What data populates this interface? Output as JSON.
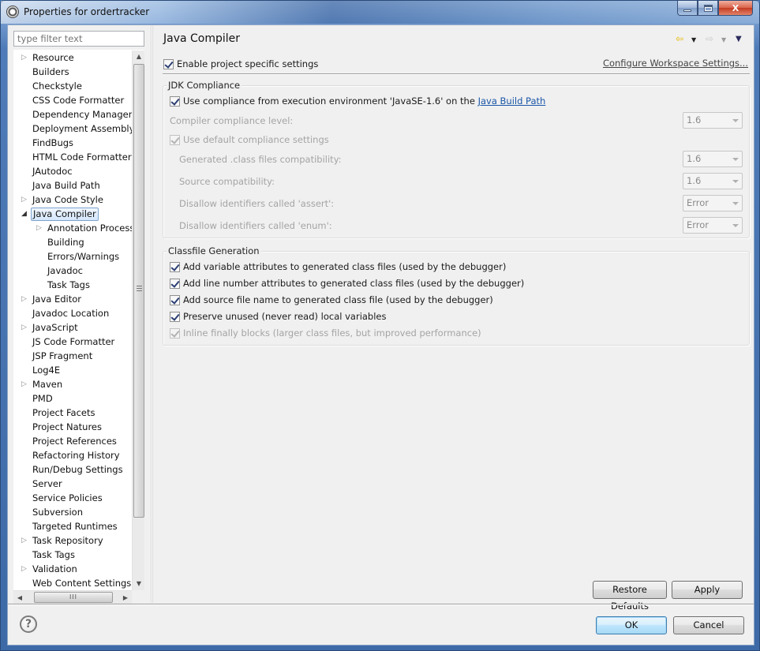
{
  "window": {
    "title": "Properties for ordertracker",
    "controls": {
      "minimize": "minimize",
      "maximize": "maximize",
      "close": "X"
    }
  },
  "sidebar": {
    "filter": {
      "value": "",
      "placeholder": "type filter text"
    },
    "items": [
      {
        "label": "Resource",
        "expandable": true,
        "expanded": false,
        "level": 0
      },
      {
        "label": "Builders",
        "expandable": false,
        "level": 0
      },
      {
        "label": "Checkstyle",
        "expandable": false,
        "level": 0
      },
      {
        "label": "CSS Code Formatter",
        "expandable": false,
        "level": 0
      },
      {
        "label": "Dependency Management",
        "expandable": false,
        "level": 0
      },
      {
        "label": "Deployment Assembly",
        "expandable": false,
        "level": 0
      },
      {
        "label": "FindBugs",
        "expandable": false,
        "level": 0
      },
      {
        "label": "HTML Code Formatter",
        "expandable": false,
        "level": 0
      },
      {
        "label": "JAutodoc",
        "expandable": false,
        "level": 0
      },
      {
        "label": "Java Build Path",
        "expandable": false,
        "level": 0
      },
      {
        "label": "Java Code Style",
        "expandable": true,
        "expanded": false,
        "level": 0
      },
      {
        "label": "Java Compiler",
        "expandable": true,
        "expanded": true,
        "level": 0,
        "selected": true
      },
      {
        "label": "Annotation Processing",
        "expandable": true,
        "expanded": false,
        "level": 1
      },
      {
        "label": "Building",
        "expandable": false,
        "level": 1
      },
      {
        "label": "Errors/Warnings",
        "expandable": false,
        "level": 1
      },
      {
        "label": "Javadoc",
        "expandable": false,
        "level": 1
      },
      {
        "label": "Task Tags",
        "expandable": false,
        "level": 1
      },
      {
        "label": "Java Editor",
        "expandable": true,
        "expanded": false,
        "level": 0
      },
      {
        "label": "Javadoc Location",
        "expandable": false,
        "level": 0
      },
      {
        "label": "JavaScript",
        "expandable": true,
        "expanded": false,
        "level": 0
      },
      {
        "label": "JS Code Formatter",
        "expandable": false,
        "level": 0
      },
      {
        "label": "JSP Fragment",
        "expandable": false,
        "level": 0
      },
      {
        "label": "Log4E",
        "expandable": false,
        "level": 0
      },
      {
        "label": "Maven",
        "expandable": true,
        "expanded": false,
        "level": 0
      },
      {
        "label": "PMD",
        "expandable": false,
        "level": 0
      },
      {
        "label": "Project Facets",
        "expandable": false,
        "level": 0
      },
      {
        "label": "Project Natures",
        "expandable": false,
        "level": 0
      },
      {
        "label": "Project References",
        "expandable": false,
        "level": 0
      },
      {
        "label": "Refactoring History",
        "expandable": false,
        "level": 0
      },
      {
        "label": "Run/Debug Settings",
        "expandable": false,
        "level": 0
      },
      {
        "label": "Server",
        "expandable": false,
        "level": 0
      },
      {
        "label": "Service Policies",
        "expandable": false,
        "level": 0
      },
      {
        "label": "Subversion",
        "expandable": false,
        "level": 0
      },
      {
        "label": "Targeted Runtimes",
        "expandable": false,
        "level": 0
      },
      {
        "label": "Task Repository",
        "expandable": true,
        "expanded": false,
        "level": 0
      },
      {
        "label": "Task Tags",
        "expandable": false,
        "level": 0
      },
      {
        "label": "Validation",
        "expandable": true,
        "expanded": false,
        "level": 0
      },
      {
        "label": "Web Content Settings",
        "expandable": false,
        "level": 0
      }
    ],
    "scroll": {
      "grip": "III"
    }
  },
  "page": {
    "title": "Java Compiler",
    "nav": {
      "back": "back",
      "forward": "forward",
      "menu": "view-menu"
    },
    "enable_project_specific": {
      "label": "Enable project specific settings",
      "checked": true
    },
    "configure_link": "Configure Workspace Settings...",
    "jdk_compliance": {
      "title": "JDK Compliance",
      "use_ee": {
        "checked": true,
        "label_prefix": "Use compliance from execution environment 'JavaSE-1.6' on the ",
        "link": "Java Build Path"
      },
      "compiler_level": {
        "label": "Compiler compliance level:",
        "value": "1.6",
        "enabled": false
      },
      "use_default": {
        "label": "Use default compliance settings",
        "checked": true,
        "enabled": false
      },
      "generated_compat": {
        "label": "Generated .class files compatibility:",
        "value": "1.6",
        "enabled": false
      },
      "source_compat": {
        "label": "Source compatibility:",
        "value": "1.6",
        "enabled": false
      },
      "disallow_assert": {
        "label": "Disallow identifiers called 'assert':",
        "value": "Error",
        "enabled": false
      },
      "disallow_enum": {
        "label": "Disallow identifiers called 'enum':",
        "value": "Error",
        "enabled": false
      }
    },
    "classfile_generation": {
      "title": "Classfile Generation",
      "options": [
        {
          "label": "Add variable attributes to generated class files (used by the debugger)",
          "checked": true,
          "enabled": true
        },
        {
          "label": "Add line number attributes to generated class files (used by the debugger)",
          "checked": true,
          "enabled": true
        },
        {
          "label": "Add source file name to generated class file (used by the debugger)",
          "checked": true,
          "enabled": true
        },
        {
          "label": "Preserve unused (never read) local variables",
          "checked": true,
          "enabled": true
        },
        {
          "label": "Inline finally blocks (larger class files, but improved performance)",
          "checked": true,
          "enabled": false
        }
      ]
    },
    "restore_defaults_label": "Restore Defaults",
    "apply_label": "Apply"
  },
  "footer": {
    "help": "?",
    "ok_label": "OK",
    "cancel_label": "Cancel"
  }
}
